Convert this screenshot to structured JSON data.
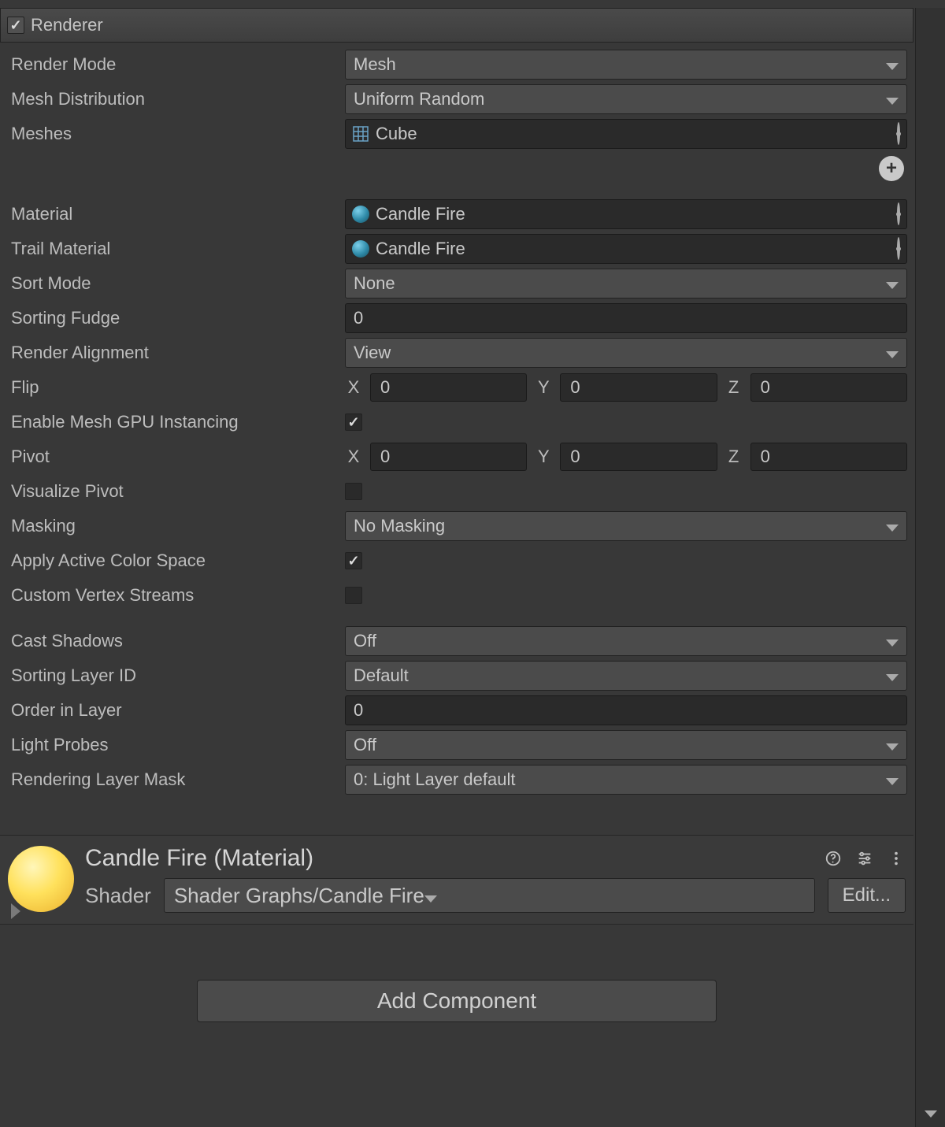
{
  "section": {
    "title": "Renderer",
    "enabled": true
  },
  "labels": {
    "renderMode": "Render Mode",
    "meshDistribution": "Mesh Distribution",
    "meshes": "Meshes",
    "material": "Material",
    "trailMaterial": "Trail Material",
    "sortMode": "Sort Mode",
    "sortingFudge": "Sorting Fudge",
    "renderAlignment": "Render Alignment",
    "flip": "Flip",
    "enableGPU": "Enable Mesh GPU Instancing",
    "pivot": "Pivot",
    "visualizePivot": "Visualize Pivot",
    "masking": "Masking",
    "applyColorSpace": "Apply Active Color Space",
    "customVertexStreams": "Custom Vertex Streams",
    "castShadows": "Cast Shadows",
    "sortingLayerId": "Sorting Layer ID",
    "orderInLayer": "Order in Layer",
    "lightProbes": "Light Probes",
    "renderingLayerMask": "Rendering Layer Mask"
  },
  "values": {
    "renderMode": "Mesh",
    "meshDistribution": "Uniform Random",
    "mesh": "Cube",
    "material": "Candle Fire",
    "trailMaterial": "Candle Fire",
    "sortMode": "None",
    "sortingFudge": "0",
    "renderAlignment": "View",
    "flip": {
      "x": "0",
      "y": "0",
      "z": "0"
    },
    "enableGPU": true,
    "pivot": {
      "x": "0",
      "y": "0",
      "z": "0"
    },
    "visualizePivot": false,
    "masking": "No Masking",
    "applyColorSpace": true,
    "customVertexStreams": false,
    "castShadows": "Off",
    "sortingLayerId": "Default",
    "orderInLayer": "0",
    "lightProbes": "Off",
    "renderingLayerMask": "0: Light Layer default"
  },
  "axes": {
    "x": "X",
    "y": "Y",
    "z": "Z"
  },
  "materialPanel": {
    "title": "Candle Fire (Material)",
    "shaderLabel": "Shader",
    "shader": "Shader Graphs/Candle Fire",
    "editLabel": "Edit..."
  },
  "addComponent": "Add Component"
}
